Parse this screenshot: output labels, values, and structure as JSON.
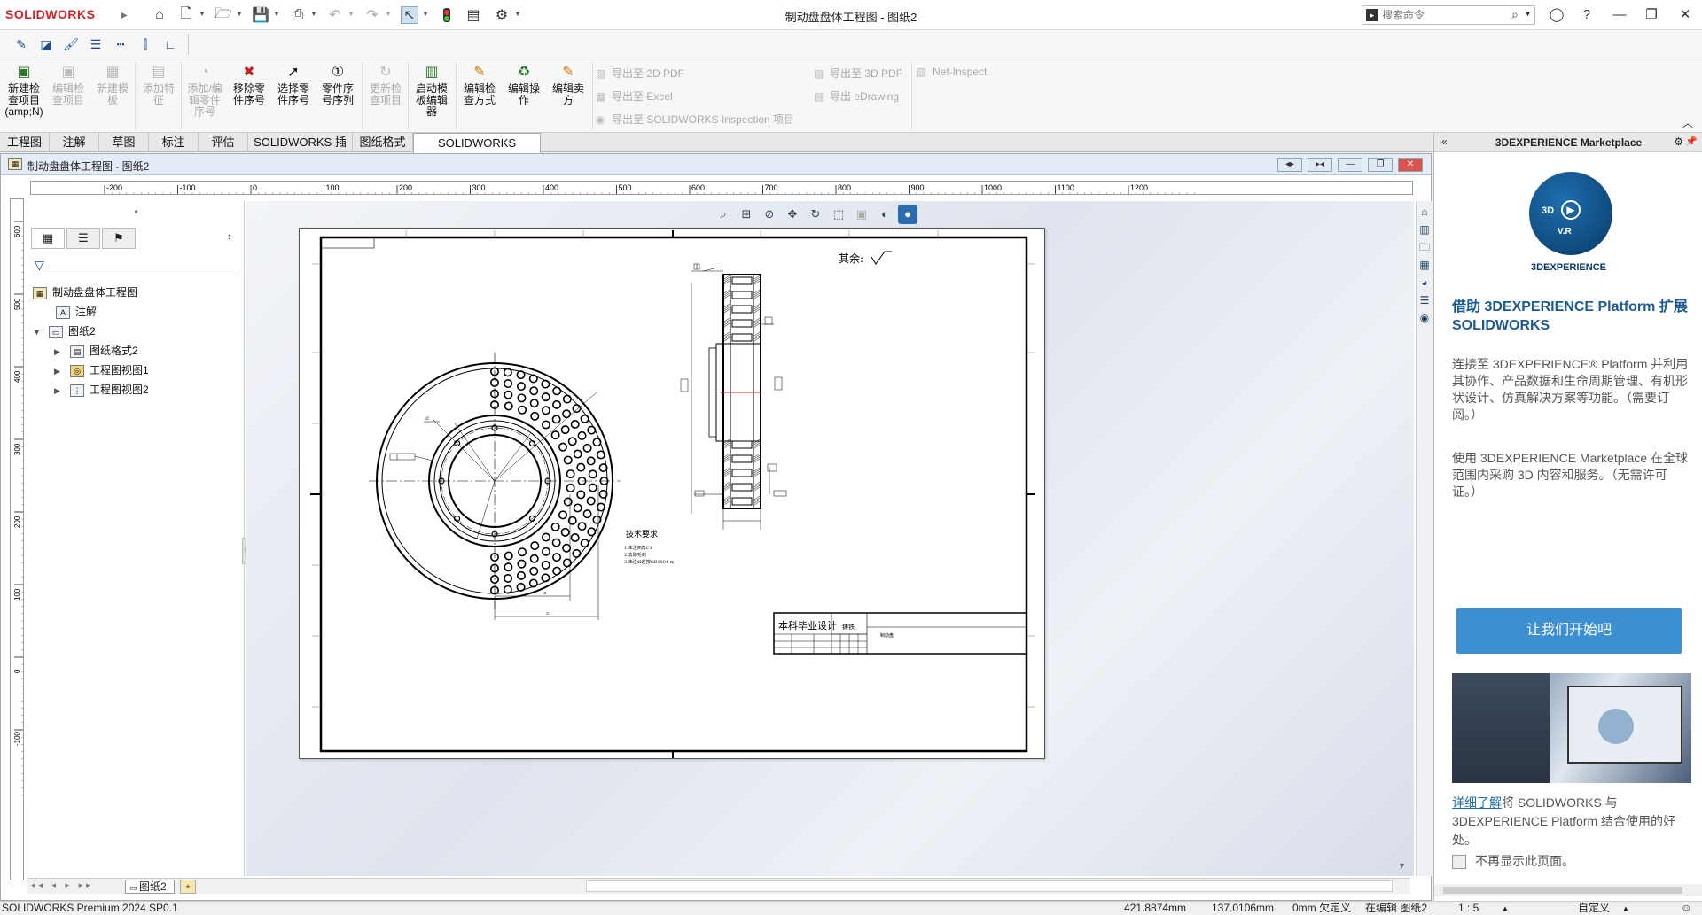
{
  "app": {
    "logo": "SOLIDWORKS",
    "window_title": "制动盘盘体工程图 - 图纸2",
    "search_placeholder": "搜索命令"
  },
  "ribbon": {
    "large_buttons": [
      {
        "label": "新建检查项目(amp;N)",
        "enabled": true,
        "icon": "new-inspection-icon"
      },
      {
        "label": "编辑检查项目",
        "enabled": false,
        "icon": "edit-inspection-icon"
      },
      {
        "label": "新建模板",
        "enabled": false,
        "icon": "new-template-icon"
      },
      {
        "label": "添加特征",
        "enabled": false,
        "icon": "add-feature-icon"
      },
      {
        "label": "添加/编辑零件序号",
        "enabled": false,
        "icon": "add-balloon-icon"
      },
      {
        "label": "移除零件序号",
        "enabled": true,
        "icon": "remove-balloon-icon"
      },
      {
        "label": "选择零件序号",
        "enabled": true,
        "icon": "select-balloon-icon"
      },
      {
        "label": "零件序号序列",
        "enabled": true,
        "icon": "balloon-sequence-icon"
      },
      {
        "label": "更新检查项目",
        "enabled": false,
        "icon": "update-inspection-icon"
      },
      {
        "label": "启动模板编辑器",
        "enabled": true,
        "icon": "template-editor-icon"
      },
      {
        "label": "编辑检查方式",
        "enabled": true,
        "icon": "edit-method-icon"
      },
      {
        "label": "编辑操作",
        "enabled": true,
        "icon": "edit-operation-icon"
      },
      {
        "label": "编辑卖方",
        "enabled": true,
        "icon": "edit-vendor-icon"
      }
    ],
    "export": {
      "pdf2d": "导出至 2D PDF",
      "excel": "导出至 Excel",
      "inspection": "导出至 SOLIDWORKS Inspection 项目",
      "pdf3d": "导出至 3D PDF",
      "edrawing": "导出 eDrawing",
      "net": "Net-Inspect"
    }
  },
  "tabs": [
    "工程图",
    "注解",
    "草图",
    "标注",
    "评估",
    "SOLIDWORKS 插件",
    "图纸格式",
    "SOLIDWORKS Inspection"
  ],
  "active_tab": "SOLIDWORKS Inspection",
  "document": {
    "title": "制动盘盘体工程图 - 图纸2",
    "hruler_ticks": [
      "-200",
      "-100",
      "0",
      "100",
      "200",
      "300",
      "400",
      "500",
      "600",
      "700",
      "800",
      "900",
      "1000",
      "1100",
      "1200"
    ],
    "vruler_ticks": [
      "600",
      "500",
      "400",
      "300",
      "200",
      "100",
      "0",
      "-100"
    ]
  },
  "tree": {
    "root": "制动盘盘体工程图",
    "nodes": [
      {
        "label": "注解",
        "depth": 1,
        "expandable": false
      },
      {
        "label": "图纸2",
        "depth": 1,
        "expandable": true,
        "expanded": true
      },
      {
        "label": "图纸格式2",
        "depth": 2,
        "expandable": true
      },
      {
        "label": "工程图视图1",
        "depth": 2,
        "expandable": true
      },
      {
        "label": "工程图视图2",
        "depth": 2,
        "expandable": true
      }
    ]
  },
  "drawing": {
    "roughness_note": "其余:",
    "tech_title": "技术要求",
    "tech_lines": [
      "1.未注倒角C1",
      "2.去除毛刺",
      "3.未注公差按GB1804-m"
    ],
    "titleblock": {
      "main": "本科毕业设计",
      "material": "铸铁",
      "right": "制动盘"
    }
  },
  "sheet_tab": "图纸2",
  "status": {
    "product": "SOLIDWORKS Premium 2024 SP0.1",
    "x": "421.8874mm",
    "y": "137.0106mm",
    "z": "0mm",
    "constraint": "欠定义",
    "editing": "在编辑 图纸2",
    "scale": "1 : 5",
    "units": "自定义"
  },
  "panel": {
    "title": "3DEXPERIENCE Marketplace",
    "brand": "3DEXPERIENCE",
    "badge_text": "V.R",
    "headline": "借助 3DEXPERIENCE Platform 扩展 SOLIDWORKS",
    "para1": "连接至 3DEXPERIENCE® Platform 并利用其协作、产品数据和生命周期管理、有机形状设计、仿真解决方案等功能。（需要订阅。）",
    "para2": "使用 3DEXPERIENCE Marketplace 在全球范围内采购 3D 内容和服务。（无需许可证。）",
    "cta": "让我们开始吧",
    "learn_link": "详细了解",
    "learn_rest": "将 SOLIDWORKS 与 3DEXPERIENCE Platform 结合使用的好处。",
    "no_show": "不再显示此页面。"
  }
}
